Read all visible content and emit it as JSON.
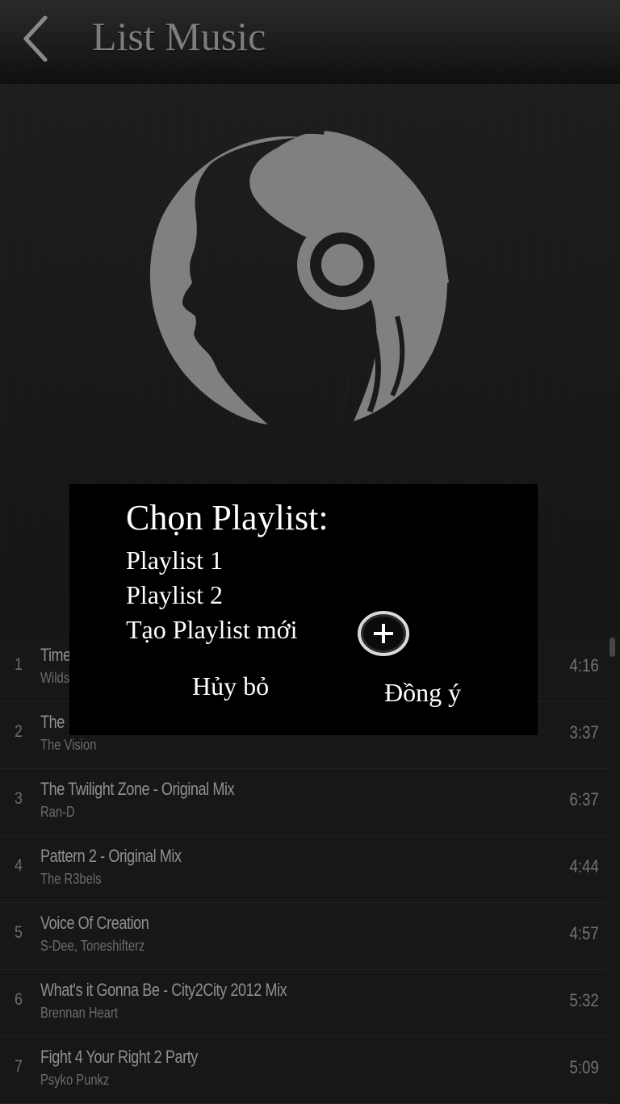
{
  "header": {
    "title": "List Music",
    "back_icon": "chevron-left-icon"
  },
  "hero": {
    "logo_icon": "headphones-woman-icon"
  },
  "tracks": [
    {
      "num": "1",
      "title": "Time",
      "artist": "Wildst",
      "duration": "4:16"
    },
    {
      "num": "2",
      "title": "The E",
      "artist": "The Vision",
      "duration": "3:37"
    },
    {
      "num": "3",
      "title": "The Twilight Zone - Original Mix",
      "artist": "Ran-D",
      "duration": "6:37"
    },
    {
      "num": "4",
      "title": "Pattern 2 - Original Mix",
      "artist": "The R3bels",
      "duration": "4:44"
    },
    {
      "num": "5",
      "title": "Voice Of Creation",
      "artist": "S-Dee, Toneshifterz",
      "duration": "4:57"
    },
    {
      "num": "6",
      "title": "What's it Gonna Be - City2City 2012 Mix",
      "artist": "Brennan Heart",
      "duration": "5:32"
    },
    {
      "num": "7",
      "title": "Fight 4 Your Right 2 Party",
      "artist": "Psyko Punkz",
      "duration": "5:09"
    }
  ],
  "dialog": {
    "title": "Chọn Playlist:",
    "options": [
      "Playlist 1",
      "Playlist 2",
      "Tạo Playlist mới"
    ],
    "add_icon": "plus-circle-icon",
    "cancel_label": "Hủy bỏ",
    "confirm_label": "Đồng ý"
  },
  "colors": {
    "background": "#161616",
    "dialog": "#000000",
    "logo": "#808080"
  }
}
